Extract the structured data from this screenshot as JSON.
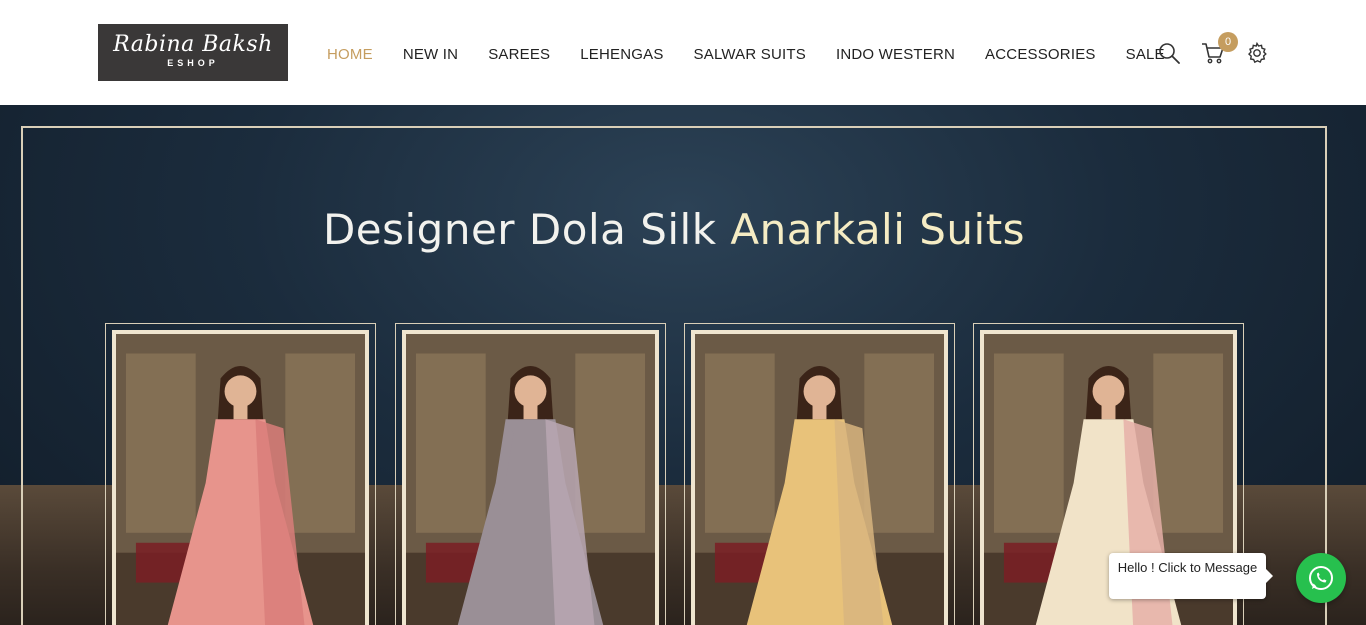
{
  "brand": {
    "name": "Rabina Baksh",
    "sub": "ESHOP"
  },
  "nav": {
    "items": [
      {
        "label": "HOME",
        "active": true
      },
      {
        "label": "NEW IN",
        "active": false
      },
      {
        "label": "SAREES",
        "active": false
      },
      {
        "label": "LEHENGAS",
        "active": false
      },
      {
        "label": "SALWAR SUITS",
        "active": false
      },
      {
        "label": "INDO WESTERN",
        "active": false
      },
      {
        "label": "ACCESSORIES",
        "active": false
      },
      {
        "label": "SALE",
        "active": false
      }
    ]
  },
  "header_icons": {
    "search": "search-icon",
    "cart": "cart-icon",
    "settings": "gear-icon",
    "cart_count": "0"
  },
  "banner": {
    "title_main": "Designer Dola Silk ",
    "title_accent": "Anarkali Suits",
    "products": [
      {
        "name": "pink-anarkali",
        "dress_color": "#e7948c",
        "dupatta_color": "#d97e7a"
      },
      {
        "name": "grey-anarkali",
        "dress_color": "#9a8f96",
        "dupatta_color": "#b9a7b3"
      },
      {
        "name": "yellow-anarkali",
        "dress_color": "#e8c27a",
        "dupatta_color": "#d8b57f"
      },
      {
        "name": "cream-anarkali",
        "dress_color": "#f1e3c8",
        "dupatta_color": "#e6b0a8"
      }
    ]
  },
  "chat": {
    "message": "Hello ! Click to Message",
    "icon": "whatsapp-icon"
  },
  "colors": {
    "accent": "#c59d5f",
    "whatsapp": "#27c04e",
    "logo_bg": "#3a3838"
  }
}
